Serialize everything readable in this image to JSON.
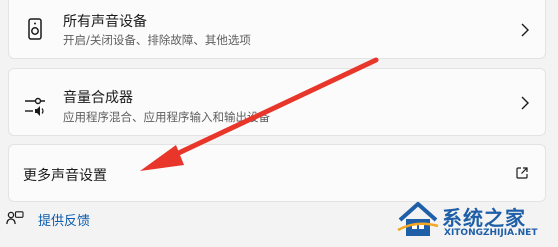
{
  "cards": [
    {
      "title": "所有声音设备",
      "desc": "开启/关闭设备、排除故障、其他选项",
      "icon": "speaker-device-icon",
      "action_icon": "chevron-right-icon"
    },
    {
      "title": "音量合成器",
      "desc": "应用程序混合、应用程序输入和输出设备",
      "icon": "volume-mixer-icon",
      "action_icon": "chevron-right-icon"
    },
    {
      "title": "更多声音设置",
      "action_icon": "external-link-icon"
    }
  ],
  "feedback": {
    "label": "提供反馈",
    "icon": "feedback-icon"
  },
  "watermark": {
    "brand": "系统之家",
    "domain": "XITONGZHIJIA.NET"
  },
  "colors": {
    "background": "#f3f3f3",
    "card": "#fbfbfb",
    "link": "#0b5cad",
    "arrow": "#e8362b",
    "watermark": "#1e5fa8"
  }
}
